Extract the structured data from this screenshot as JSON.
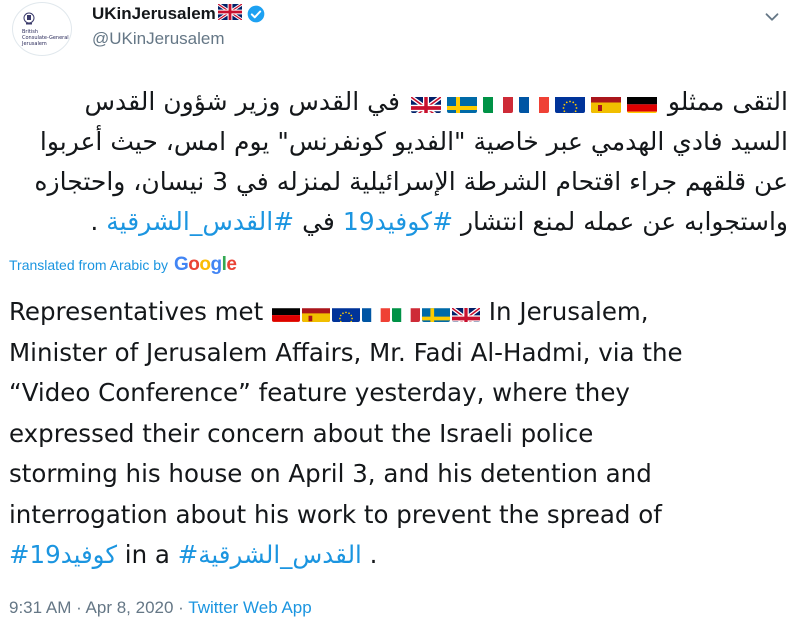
{
  "user": {
    "display_name": "UKinJerusalem",
    "handle": "@UKinJerusalem",
    "avatar_lines": [
      "British",
      "Consulate-General",
      "Jerusalem"
    ],
    "verified_color": "#1da1f2"
  },
  "tweet": {
    "arabic_lines": [
      {
        "pre": "التقى ممثلو ",
        "flags": [
          "germany",
          "spain",
          "eu",
          "france",
          "italy",
          "sweden",
          "uk"
        ],
        "post": " في القدس وزير شؤون القدس"
      },
      {
        "text": "السيد فادي الهدمي عبر خاصية \"الفديو كونفرنس\" يوم امس، حيث أعربوا"
      },
      {
        "text": "عن قلقهم جراء اقتحام الشرطة الإسرائيلية لمنزله في 3 نيسان، واحتجازه"
      },
      {
        "pre": "واستجوابه عن عمله لمنع انتشار ",
        "hashtag1": "#كوفيد19",
        "mid": " في ",
        "hashtag2": "#القدس_الشرقية",
        "post": "."
      }
    ],
    "translated_label": "Translated from Arabic by",
    "translation_provider": "Google",
    "english_lines": [
      {
        "pre": "Representatives met ",
        "flags": [
          "germany",
          "spain",
          "eu",
          "france",
          "italy",
          "sweden",
          "uk"
        ],
        "post": " In Jerusalem,"
      },
      {
        "text": "Minister of Jerusalem Affairs, Mr. Fadi Al-Hadmi, via the"
      },
      {
        "text": "“Video Conference” feature yesterday, where they"
      },
      {
        "text": "expressed their concern about the Israeli police"
      },
      {
        "text": "storming his house on April 3, and his detention and"
      },
      {
        "text": "interrogation about his work to prevent the spread of"
      },
      {
        "hashtag1": "#كوفيد19",
        "mid": " in a ",
        "hashtag2": "#القدس_الشرقية",
        "post": " ."
      }
    ],
    "timestamp": "9:31 AM · Apr 8, 2020 · ",
    "source": "Twitter Web App"
  },
  "colors": {
    "link": "#1b95e0",
    "text": "#14171a",
    "muted": "#657786"
  },
  "icons": {
    "caret": "chevron-down-icon",
    "verified": "verified-badge-icon"
  }
}
